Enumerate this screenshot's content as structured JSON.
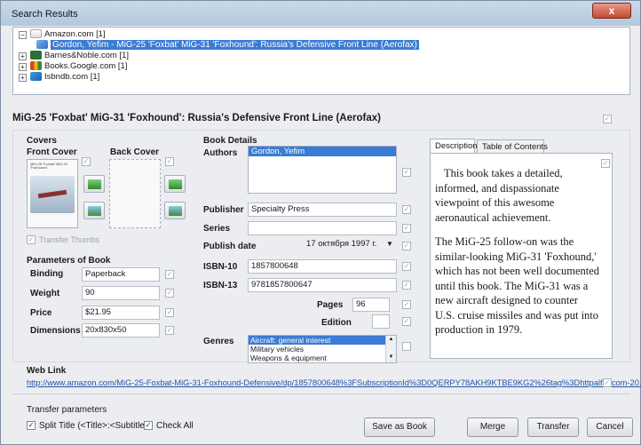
{
  "window": {
    "title": "Search Results",
    "close_label": "x"
  },
  "tree": [
    {
      "label": "Amazon.com [1]",
      "expander": "−"
    },
    {
      "label": "Gordon, Yefim - MiG-25 'Foxbat' MiG-31 'Foxhound': Russia's Defensive Front Line (Aerofax)"
    },
    {
      "label": "Barnes&Noble.com [1]",
      "expander": "+"
    },
    {
      "label": "Books.Google.com [1]",
      "expander": "+"
    },
    {
      "label": "Isbndb.com [1]",
      "expander": "+"
    }
  ],
  "book_title": "MiG-25 'Foxbat' MiG-31 'Foxhound': Russia's Defensive Front Line (Aerofax)",
  "covers": {
    "heading": "Covers",
    "front": "Front Cover",
    "back": "Back Cover",
    "transfer_thumbs": "Transfer Thumbs",
    "thumb_text": "MiG-25 'Foxbat' MiG-31 'Foxhound'"
  },
  "params": {
    "heading": "Parameters of Book",
    "binding_label": "Binding",
    "binding": "Paperback",
    "weight_label": "Weight",
    "weight": "90",
    "price_label": "Price",
    "price": "$21.95",
    "dimensions_label": "Dimensions",
    "dimensions": "20x830x50"
  },
  "details": {
    "heading": "Book Details",
    "authors_label": "Authors",
    "authors": "Gordon, Yefim",
    "publisher_label": "Publisher",
    "publisher": "Specialty Press",
    "series_label": "Series",
    "series": "",
    "publish_date_label": "Publish date",
    "publish_date": "17 октября 1997 г.",
    "isbn10_label": "ISBN-10",
    "isbn10": "1857800648",
    "isbn13_label": "ISBN-13",
    "isbn13": "9781857800647",
    "pages_label": "Pages",
    "pages": "96",
    "edition_label": "Edition",
    "edition": "",
    "genres_label": "Genres",
    "genres": [
      "Aircraft: general interest",
      "Military vehicles",
      "Weapons & equipment"
    ]
  },
  "description": {
    "tabs": [
      "Description",
      "Table of Contents"
    ],
    "p1": "This book takes a detailed, informed, and dispassionate viewpoint of this awesome aeronautical achievement.",
    "p2": "The MiG-25 follow-on was the similar-looking MiG-31 'Foxhound,' which has not been well documented until this book. The MiG-31 was a new aircraft designed to counter U.S. cruise missiles and was put into production in 1979."
  },
  "web_link": {
    "heading": "Web Link",
    "url": "http://www.amazon.com/MiG-25-Foxbat-MiG-31-Foxhound-Defensive/dp/1857800648%3FSubscriptionId%3D0QERPY78AKH9KTBE9KG2%26tag%3Dhttpalfaecom-20..."
  },
  "transfer": {
    "heading": "Transfer parameters",
    "split_title": "Split Title (<Title>:<Subtitle>)",
    "check_all": "Check All"
  },
  "buttons": {
    "save_as_book": "Save as Book",
    "merge": "Merge",
    "transfer": "Transfer",
    "cancel": "Cancel"
  },
  "colors": {
    "selection": "#3a7bd5",
    "link": "#2554a8",
    "titlebar": "#b3c8de"
  }
}
